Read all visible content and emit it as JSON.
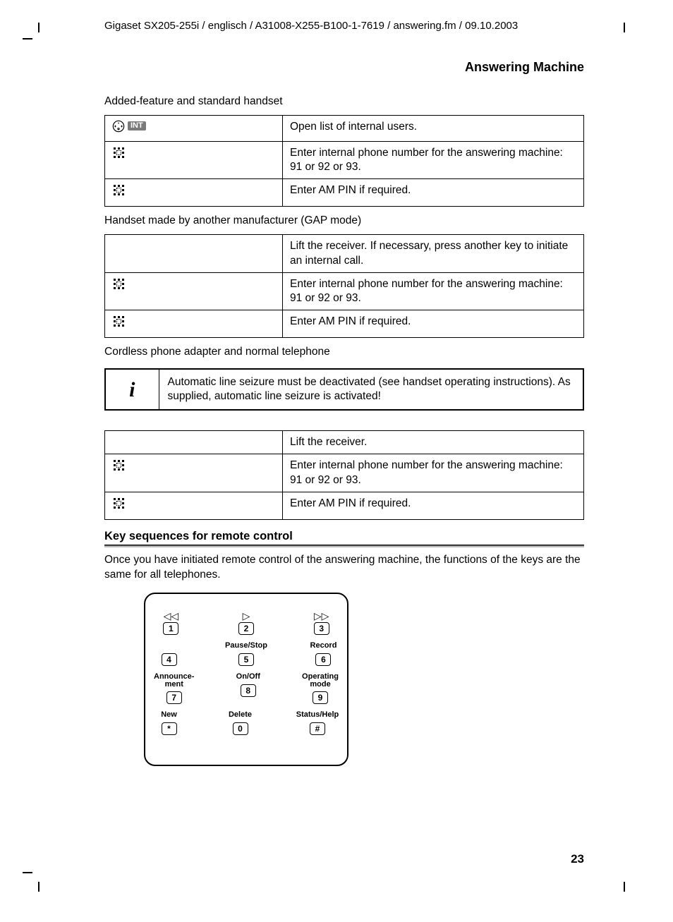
{
  "header_path": "Gigaset SX205-255i / englisch / A31008-X255-B100-1-7619 / answering.fm / 09.10.2003",
  "section_title": "Answering Machine",
  "intro1": "Added-feature and standard handset",
  "int_label": "INT",
  "table1": {
    "r1": "Open list of internal users.",
    "r2": "Enter internal phone number for the answering machine: 91 or 92 or 93.",
    "r3": "Enter AM PIN if required."
  },
  "intro2": "Handset made by another manufacturer (GAP mode)",
  "table2": {
    "r1": "Lift the receiver. If necessary, press another key to initiate an internal call.",
    "r2": "Enter internal phone number for the answering machine: 91 or 92 or 93.",
    "r3": "Enter AM PIN if required."
  },
  "intro3": "Cordless phone adapter and normal telephone",
  "info_text": "Automatic line seizure must be deactivated (see handset operating instructions). As supplied, automatic line seizure is activated!",
  "table3": {
    "r1": "Lift the receiver.",
    "r2": "Enter internal phone number for the answering machine: 91 or 92 or 93.",
    "r3": "Enter AM PIN if required."
  },
  "subsection_title": "Key sequences for remote control",
  "subsection_text": "Once you have initiated remote control of the answering machine, the functions of the keys are the same for all telephones.",
  "keypad": {
    "labels": {
      "k2_glyph": "▷",
      "k1_glyph": "◁◁",
      "k3_glyph": "▷▷",
      "k5": "Pause/Stop",
      "k6": "Record",
      "k7": "Announce-\nment",
      "k8": "On/Off",
      "k9": "Operating mode",
      "kstar": "New",
      "k0": "Delete",
      "khash": "Status/Help"
    },
    "keys": {
      "k1": "1",
      "k2": "2",
      "k3": "3",
      "k4": "4",
      "k5": "5",
      "k6": "6",
      "k7": "7",
      "k8": "8",
      "k9": "9",
      "kstar": "*",
      "k0": "0",
      "khash": "#"
    }
  },
  "page_number": "23"
}
